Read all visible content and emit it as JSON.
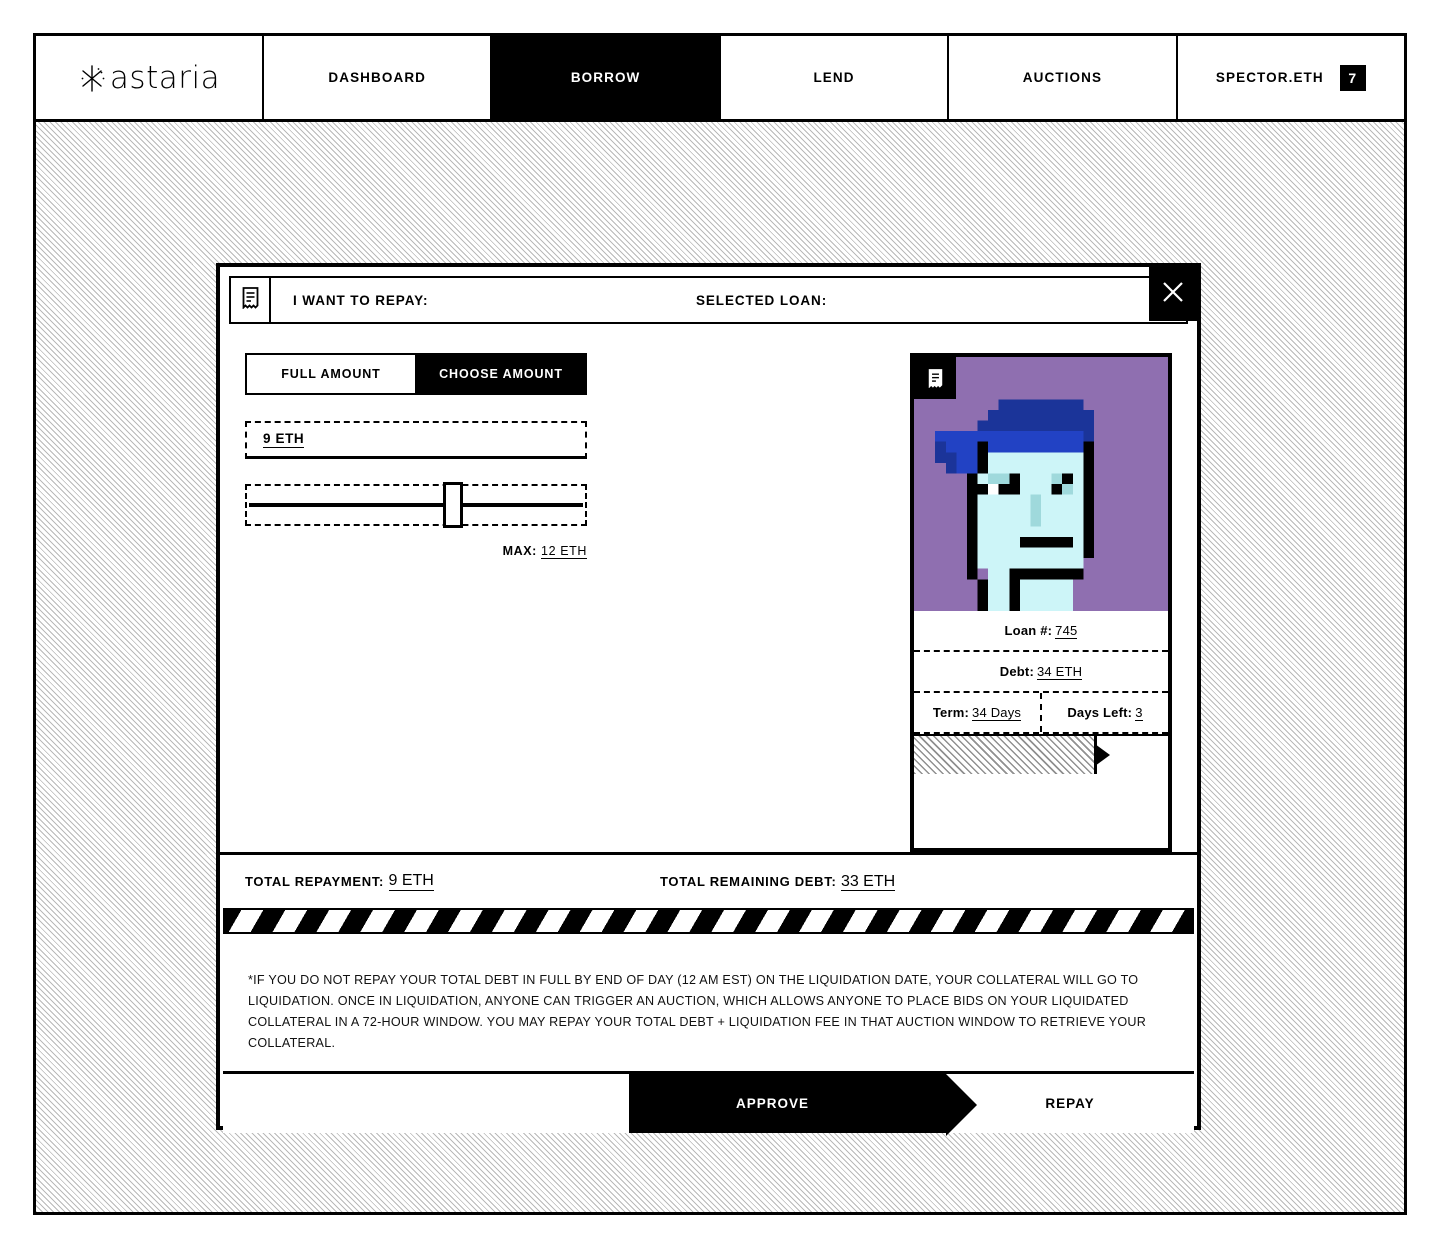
{
  "nav": {
    "logo_text": "astaria",
    "items": [
      {
        "label": "DASHBOARD",
        "active": false
      },
      {
        "label": "BORROW",
        "active": true
      },
      {
        "label": "LEND",
        "active": false
      },
      {
        "label": "AUCTIONS",
        "active": false
      }
    ],
    "account": {
      "label": "SPECTOR.ETH",
      "badge": "7"
    }
  },
  "modal": {
    "header": {
      "repay_label": "I WANT TO REPAY:",
      "selected_loan_label": "SELECTED LOAN:"
    },
    "amount_tabs": [
      {
        "label": "FULL AMOUNT",
        "active": false
      },
      {
        "label": "CHOOSE AMOUNT",
        "active": true
      }
    ],
    "amount_input": {
      "value": "9 ETH",
      "placeholder": "0 ETH"
    },
    "slider": {
      "value": 9,
      "min": 0,
      "max": 12,
      "percent": 61
    },
    "max": {
      "label": "MAX:",
      "value": "12 ETH"
    },
    "loan_card": {
      "loan_number_label": "Loan #:",
      "loan_number": "745",
      "debt_label": "Debt:",
      "debt": "34 ETH",
      "term_label": "Term:",
      "term": "34 Days",
      "days_left_label": "Days Left:",
      "days_left": "3",
      "progress_percent": 72
    },
    "totals": {
      "repayment_label": "TOTAL REPAYMENT:",
      "repayment_value": "9 ETH",
      "remaining_label": "TOTAL REMAINING DEBT:",
      "remaining_value": "33 ETH"
    },
    "disclaimer": "*IF YOU DO NOT REPAY YOUR TOTAL DEBT IN FULL BY END OF DAY (12 AM EST) ON THE LIQUIDATION DATE, YOUR COLLATERAL WILL GO TO LIQUIDATION. ONCE IN LIQUIDATION, ANYONE CAN TRIGGER AN AUCTION, WHICH ALLOWS ANYONE TO PLACE BIDS ON YOUR LIQUIDATED COLLATERAL IN A 72-HOUR WINDOW. YOU MAY REPAY YOUR TOTAL DEBT + LIQUIDATION FEE IN THAT AUCTION WINDOW TO RETRIEVE YOUR COLLATERAL.",
    "footer": {
      "approve_label": "APPROVE",
      "repay_label": "REPAY"
    }
  },
  "colors": {
    "accent": "#000000",
    "punk_background": "#8f6fb0",
    "punk_skin": "#cdf5f8",
    "punk_hair_dark": "#1b3499",
    "punk_hair_bright": "#2242c4",
    "punk_outline": "#000000"
  }
}
